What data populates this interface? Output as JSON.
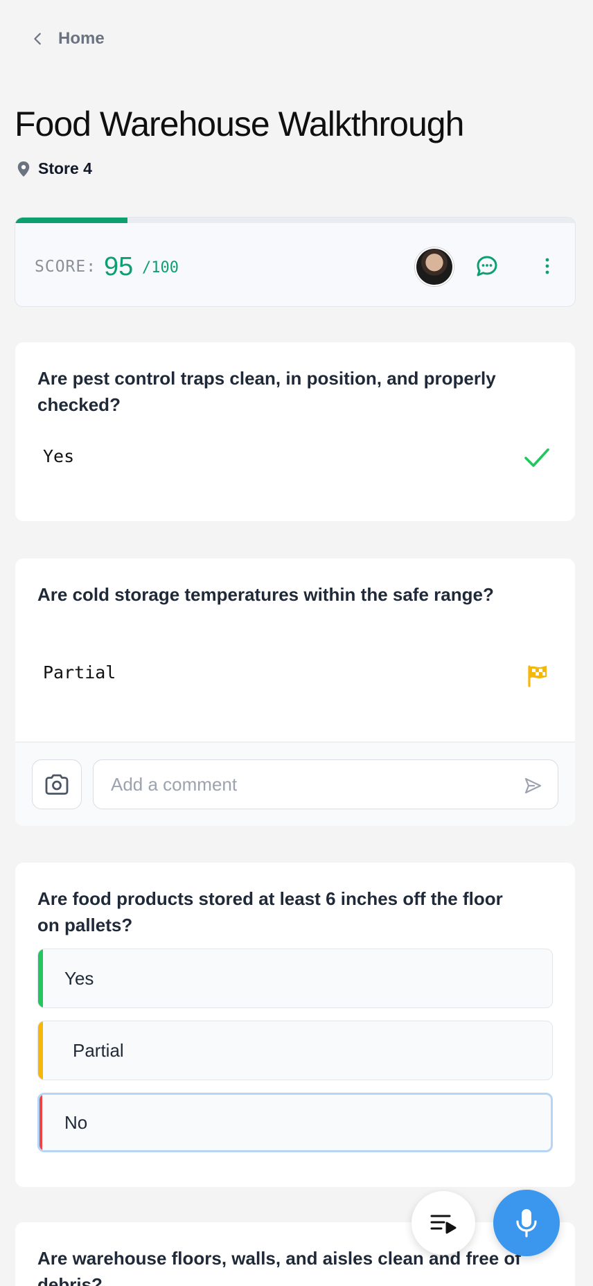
{
  "nav": {
    "back_label": "Home"
  },
  "header": {
    "title": "Food Warehouse Walkthrough",
    "location": "Store 4"
  },
  "score": {
    "label": "SCORE:",
    "value": "95",
    "max": "/100",
    "progress_fraction": 0.2
  },
  "questions": [
    {
      "text": "Are pest control traps clean, in position, and properly checked?",
      "answer": "Yes",
      "status_icon": "check-icon"
    },
    {
      "text": "Are cold storage temperatures within the safe range?",
      "answer": "Partial",
      "status_icon": "flag-icon",
      "comment_placeholder": "Add a comment"
    },
    {
      "text": "Are food products stored at least 6 inches off the floor on pallets?",
      "options": [
        "Yes",
        "Partial",
        "No"
      ]
    },
    {
      "text": "Are warehouse floors, walls, and aisles clean and free of debris?"
    }
  ],
  "colors": {
    "accent_green": "#0e9f6e",
    "yes_green": "#22c55e",
    "partial_yellow": "#f5b70a",
    "no_red": "#ef4444",
    "mic_blue": "#3b96ee"
  }
}
